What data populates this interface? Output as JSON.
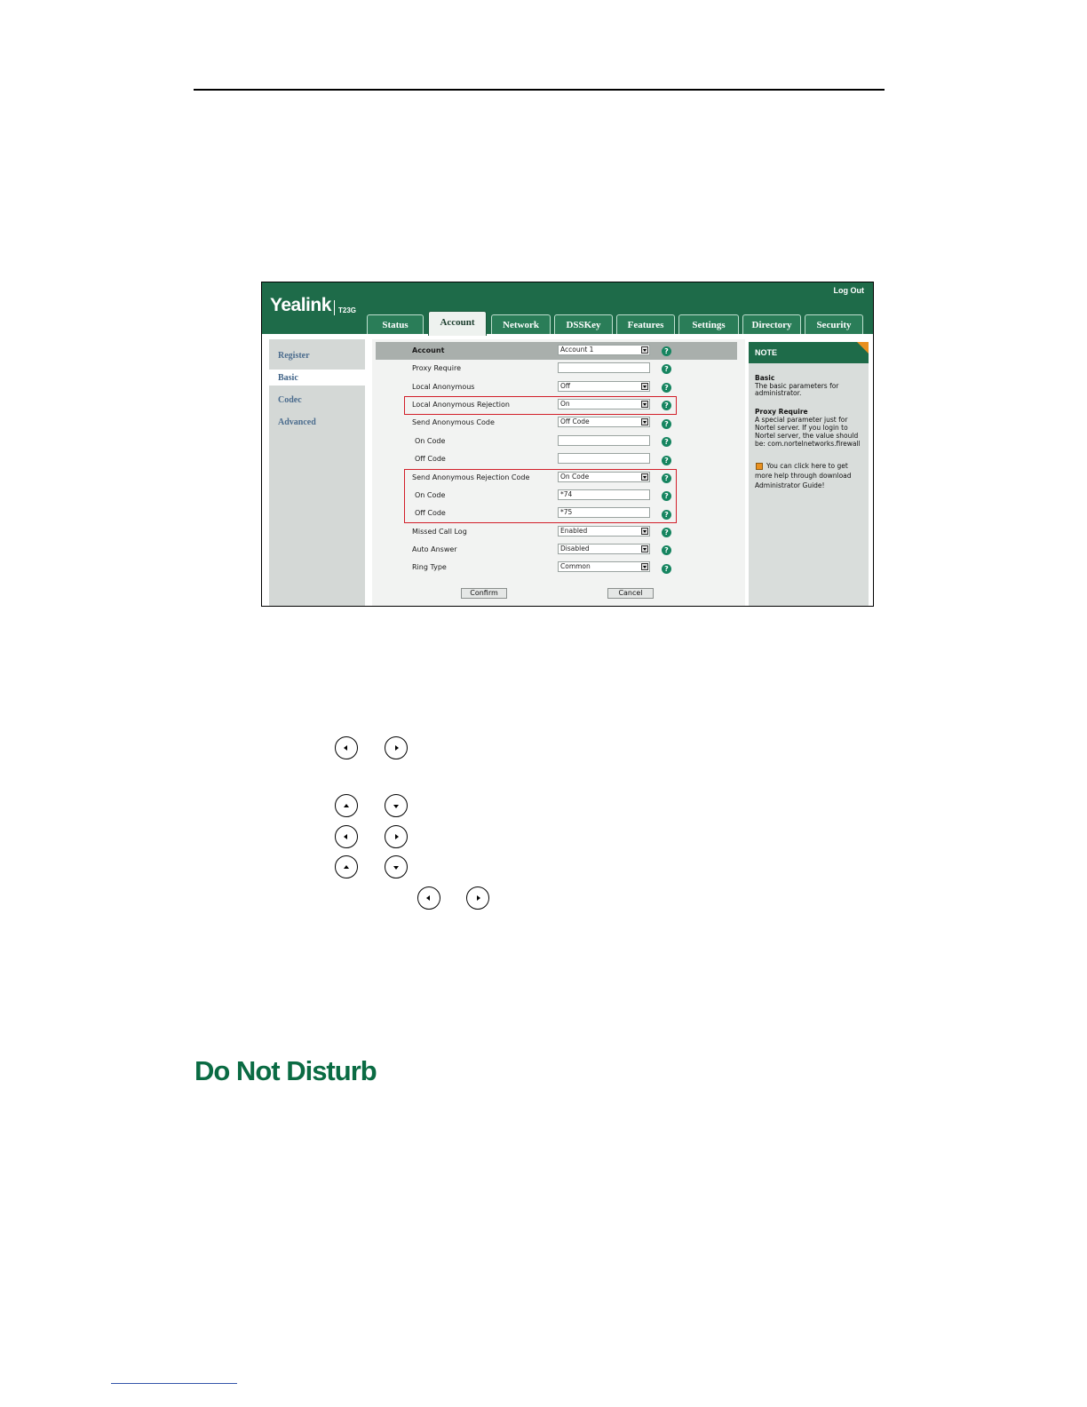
{
  "section": {
    "heading": "Do Not Disturb"
  },
  "web_ui": {
    "brand": "Yealink",
    "model": "T23G",
    "logout": "Log Out",
    "tabs": [
      "Status",
      "Account",
      "Network",
      "DSSKey",
      "Features",
      "Settings",
      "Directory",
      "Security"
    ],
    "active_tab": "Account",
    "sidebar": [
      "Register",
      "Basic",
      "Codec",
      "Advanced"
    ],
    "active_sidebar": "Basic",
    "form": {
      "account": {
        "label": "Account",
        "value": "Account 1"
      },
      "proxy_require": {
        "label": "Proxy Require",
        "value": ""
      },
      "local_anonymous": {
        "label": "Local Anonymous",
        "value": "Off"
      },
      "local_anonymous_rejection": {
        "label": "Local Anonymous Rejection",
        "value": "On"
      },
      "send_anonymous_code": {
        "label": "Send Anonymous Code",
        "value": "Off Code"
      },
      "anon_on_code": {
        "label": "On Code",
        "value": ""
      },
      "anon_off_code": {
        "label": "Off Code",
        "value": ""
      },
      "send_anonymous_rejection_code": {
        "label": "Send Anonymous Rejection Code",
        "value": "On Code"
      },
      "rej_on_code": {
        "label": "On Code",
        "value": "*74"
      },
      "rej_off_code": {
        "label": "Off Code",
        "value": "*75"
      },
      "missed_call_log": {
        "label": "Missed Call Log",
        "value": "Enabled"
      },
      "auto_answer": {
        "label": "Auto Answer",
        "value": "Disabled"
      },
      "ring_type": {
        "label": "Ring Type",
        "value": "Common"
      }
    },
    "buttons": {
      "confirm": "Confirm",
      "cancel": "Cancel"
    },
    "help_glyph": "?",
    "note": {
      "title": "NOTE",
      "basic_title": "Basic",
      "basic_lines": [
        "The basic parameters for",
        "administrator."
      ],
      "proxy_title": "Proxy Require",
      "proxy_lines": [
        "A special parameter just for",
        "Nortel server. If you login to",
        "Nortel server, the value should",
        "be: com.nortelnetworks.firewall"
      ],
      "help_lines": [
        "You can click here to get",
        "more help through download",
        "Administrator Guide!"
      ]
    }
  },
  "icons": [
    "left-key-icon",
    "right-key-icon",
    "up-key-icon",
    "down-key-icon",
    "help-icon",
    "guide-book-icon"
  ]
}
